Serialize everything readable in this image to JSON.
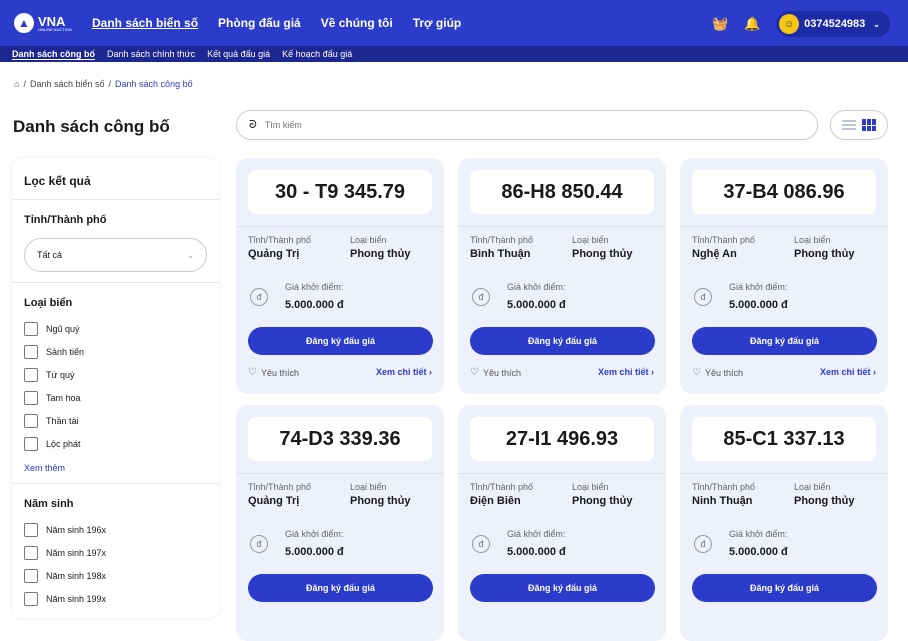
{
  "header": {
    "logo_text": "VNA",
    "logo_sub": "ONLINE AUCTION",
    "nav": [
      "Danh sách biển số",
      "Phòng đấu giá",
      "Về chúng tôi",
      "Trợ giúp"
    ],
    "phone": "0374524983"
  },
  "subnav": [
    "Danh sách công bố",
    "Danh sách chính thức",
    "Kết quả đấu giá",
    "Kế hoạch đấu giá"
  ],
  "breadcrumb": [
    "Danh sách biển số",
    "Danh sách công bố"
  ],
  "page": {
    "title": "Danh sách công bố",
    "search_placeholder": "Tìm kiếm"
  },
  "filters": {
    "title": "Lọc kết quả",
    "province_label": "Tỉnh/Thành phố",
    "province_value": "Tất cả",
    "plate_type_label": "Loại biển",
    "plate_types": [
      "Ngũ quý",
      "Sảnh tiến",
      "Tứ quý",
      "Tam hoa",
      "Thần tài",
      "Lộc phát"
    ],
    "see_more": "Xem thêm",
    "birth_year_label": "Năm sinh",
    "birth_years": [
      "Năm sinh 196x",
      "Năm sinh 197x",
      "Năm sinh 198x",
      "Năm sinh 199x"
    ]
  },
  "card_labels": {
    "province": "Tỉnh/Thành phố",
    "type": "Loại biển",
    "start_price": "Giá khởi điểm:",
    "register": "Đăng ký đấu giá",
    "favorite": "Yêu thích",
    "detail": "Xem chi tiết"
  },
  "cards": [
    {
      "plate": "30 - T9 345.79",
      "province": "Quảng Trị",
      "type": "Phong thủy",
      "price": "5.000.000 đ"
    },
    {
      "plate": "86-H8 850.44",
      "province": "Bình Thuận",
      "type": "Phong thủy",
      "price": "5.000.000 đ"
    },
    {
      "plate": "37-B4 086.96",
      "province": "Nghệ An",
      "type": "Phong thủy",
      "price": "5.000.000 đ"
    },
    {
      "plate": "74-D3 339.36",
      "province": "Quảng Trị",
      "type": "Phong thủy",
      "price": "5.000.000 đ"
    },
    {
      "plate": "27-I1 496.93",
      "province": "Điện Biên",
      "type": "Phong thủy",
      "price": "5.000.000 đ"
    },
    {
      "plate": "85-C1 337.13",
      "province": "Ninh Thuận",
      "type": "Phong thủy",
      "price": "5.000.000 đ"
    }
  ]
}
